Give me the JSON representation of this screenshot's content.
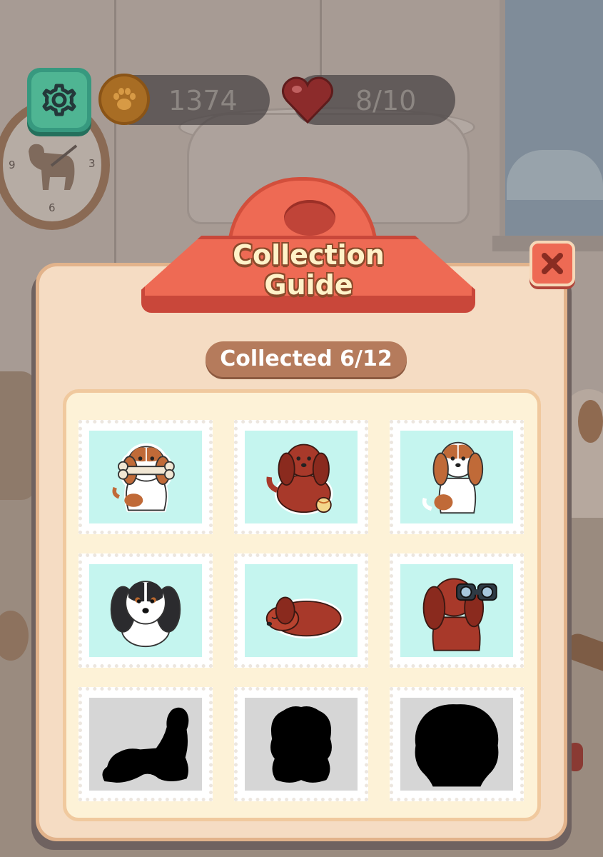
{
  "hud": {
    "coins": "1374",
    "lives": "8/10",
    "settings_icon": "gear-icon",
    "coin_icon": "paw-coin-icon",
    "lives_icon": "heart-icon"
  },
  "background": {
    "clock_numbers": [
      "9",
      "3",
      "6"
    ]
  },
  "modal": {
    "title_line1": "Collection",
    "title_line2": "Guide",
    "collected_text": "Collected 6/12",
    "close_icon": "close-icon",
    "accent_color": "#ee6a54",
    "panel_color": "#f5dcc3"
  },
  "stamps": [
    {
      "name": "dog-with-bone",
      "unlocked": true
    },
    {
      "name": "dog-with-ball",
      "unlocked": true
    },
    {
      "name": "sitting-dog",
      "unlocked": true
    },
    {
      "name": "dog-portrait",
      "unlocked": true
    },
    {
      "name": "sleeping-dog",
      "unlocked": true
    },
    {
      "name": "dog-with-binoculars",
      "unlocked": true
    },
    {
      "name": "locked-stretching-dog",
      "unlocked": false
    },
    {
      "name": "locked-sitting-dog",
      "unlocked": false
    },
    {
      "name": "locked-round-dog",
      "unlocked": false
    }
  ]
}
